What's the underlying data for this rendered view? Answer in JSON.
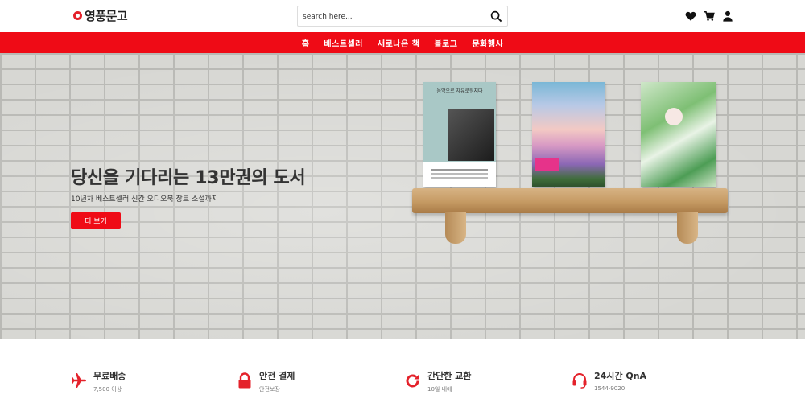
{
  "brand": {
    "name": "영풍문고",
    "accent": "#ef0b16"
  },
  "search": {
    "placeholder": "search here..."
  },
  "header_icons": [
    "heart-icon",
    "cart-icon",
    "user-icon"
  ],
  "nav": {
    "items": [
      "홈",
      "베스트셀러",
      "새로나온 책",
      "블로그",
      "문화행사"
    ]
  },
  "hero": {
    "title": "당신을 기다리는 13만권의 도서",
    "subtitle": "10년차 베스트셀러 신간 오디오북 장르 소설까지",
    "button_label": "더 보기",
    "book_titles": [
      "음악으로 자유로워지다"
    ]
  },
  "features": [
    {
      "icon": "airplane-icon",
      "title": "무료배송",
      "subtitle": "7,500 이상"
    },
    {
      "icon": "lock-icon",
      "title": "안전 결제",
      "subtitle": "안전보장"
    },
    {
      "icon": "refresh-icon",
      "title": "간단한 교환",
      "subtitle": "10일 내에"
    },
    {
      "icon": "headset-icon",
      "title": "24시간 QnA",
      "subtitle": "1544-9020"
    }
  ]
}
